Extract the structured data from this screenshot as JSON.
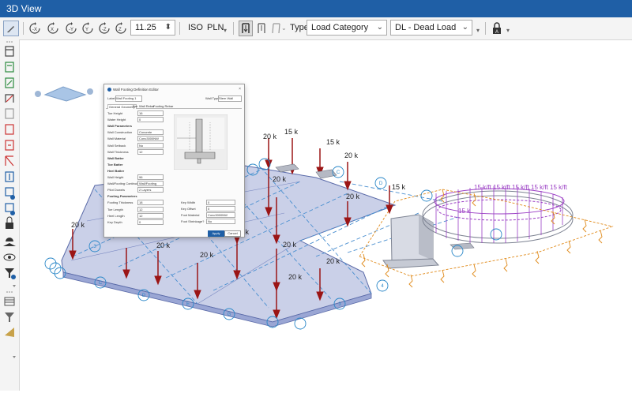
{
  "window": {
    "title": "3D View"
  },
  "toolbar": {
    "zoom_value": "11.25",
    "iso_label": "ISO",
    "pln_label": "PLN",
    "type_label": "Type",
    "category_select": "Load Category",
    "load_select": "DL - Dead Load"
  },
  "dialog": {
    "title": "Wall Footing Definition Editor",
    "label_field_caption": "Label",
    "label_value": "Wall Footing 1",
    "wall_type_caption": "Wall Type",
    "wall_type_value": "Stem Wall",
    "tabs": [
      "General Geometry",
      "Bar",
      "Wall Rebar",
      "Footing Rebar"
    ],
    "left_rows": [
      {
        "label": "Toe Height",
        "value": "16"
      },
      {
        "label": "Water Height",
        "value": "0"
      },
      {
        "label": "Wall Parameters",
        "value": ""
      },
      {
        "label": "Wall Construction",
        "value": "Concrete"
      },
      {
        "label": "Wall Material",
        "value": "Conc3000NW"
      },
      {
        "label": "Wall Setback",
        "value": "No"
      },
      {
        "label": "Wall Thickness",
        "value": "12"
      },
      {
        "label": "Wall Batter",
        "value": ""
      },
      {
        "label": "Toe Batter",
        "value": ""
      },
      {
        "label": "Heel Batter",
        "value": ""
      },
      {
        "label": "Wall Height",
        "value": "96"
      },
      {
        "label": "Wall/Footing Continuity",
        "value": "Wall/Footing"
      },
      {
        "label": "Pilot Dowels",
        "value": "2 Layers"
      },
      {
        "label": "Footing Parameters",
        "value": ""
      },
      {
        "label": "Footing Thickness",
        "value": "18"
      },
      {
        "label": "Toe Length",
        "value": "12"
      },
      {
        "label": "Heel Length",
        "value": "12"
      },
      {
        "label": "Key Depth",
        "value": "0"
      }
    ],
    "right_rows": [
      {
        "label": "Key Width",
        "value": "0"
      },
      {
        "label": "Key Offset",
        "value": "0"
      },
      {
        "label": "Foot Material",
        "value": "Conc3000NW"
      },
      {
        "label": "Foot Shrinkage?",
        "value": "No"
      }
    ],
    "apply_label": "Apply",
    "cancel_label": "Cancel"
  },
  "model": {
    "load_labels": [
      "20 k",
      "15 k",
      "15 k",
      "20 k",
      "20 k",
      "15 k",
      "20 k",
      "20 k",
      "20 k",
      "20 k",
      "20 k",
      "20 k",
      "20 k",
      "20 k"
    ],
    "grid_labels": [
      "A",
      "B",
      "C",
      "D",
      "E",
      "F",
      "G",
      "1",
      "2",
      "3",
      "4",
      "5",
      "6",
      "7"
    ]
  }
}
